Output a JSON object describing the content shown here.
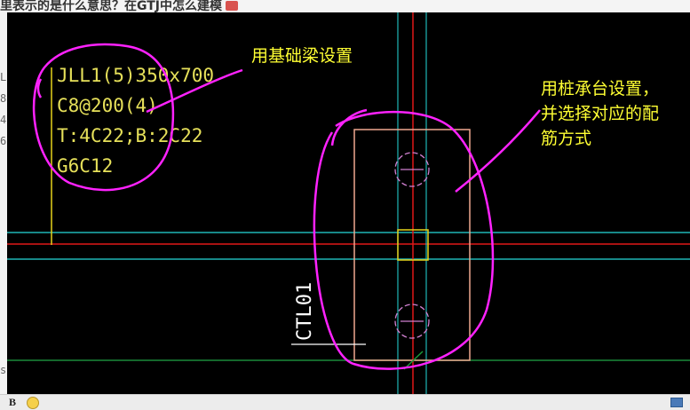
{
  "page": {
    "question_title": "里表示的是什么意思？在GTJ中怎么建模"
  },
  "left_strip": [
    "L",
    "8",
    "4",
    "6",
    "s"
  ],
  "beam_label": {
    "line1": "JLL1(5)350x700",
    "line2": "C8@200(4)",
    "line3": "T:4C22;B:2C22",
    "line4": "G6C12"
  },
  "annotations": {
    "beam_note": "用基础梁设置",
    "cap_note_line1": "用桩承台设置，",
    "cap_note_line2": "并选择对应的配",
    "cap_note_line3": "筋方式"
  },
  "cap_label": "CTL01",
  "toolbar": {
    "bold_label": "B"
  },
  "colors": {
    "cad_background": "#000000",
    "beam_text": "#e6e05a",
    "annotation_text": "#ffff33",
    "markup": "#ff22ff",
    "axis_red": "#e01818",
    "axis_cyan": "#1fb6b6",
    "cap_outline": "#f0a890",
    "column": "#e6d21a",
    "ground_green": "#1a8a3a"
  },
  "icons": [
    "bold-icon",
    "emoji-icon",
    "message-icon"
  ]
}
